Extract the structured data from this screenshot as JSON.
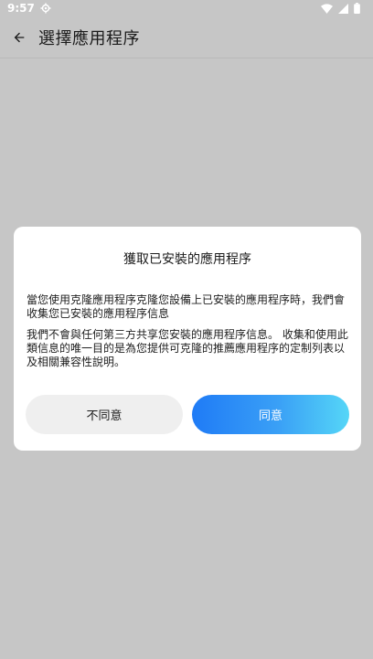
{
  "status_bar": {
    "time": "9:57",
    "settings_icon": "gear-icon",
    "wifi_icon": "wifi-icon",
    "signal_icon": "signal-icon",
    "battery_icon": "battery-icon"
  },
  "app_bar": {
    "back_icon": "arrow-left-icon",
    "title": "選擇應用程序"
  },
  "dialog": {
    "title": "獲取已安裝的應用程序",
    "paragraph_1": "當您使用克隆應用程序克隆您設備上已安裝的應用程序時，我們會收集您已安裝的應用程序信息",
    "paragraph_2": "我們不會與任何第三方共享您安裝的應用程序信息。 收集和使用此類信息的唯一目的是為您提供可克隆的推薦應用程序的定制列表以及相關兼容性說明。",
    "decline_label": "不同意",
    "agree_label": "同意"
  },
  "colors": {
    "background": "#c6c6c6",
    "dialog_background": "#ffffff",
    "decline_button": "#efefef",
    "agree_gradient_start": "#1f7bf6",
    "agree_gradient_end": "#55d6f7"
  }
}
